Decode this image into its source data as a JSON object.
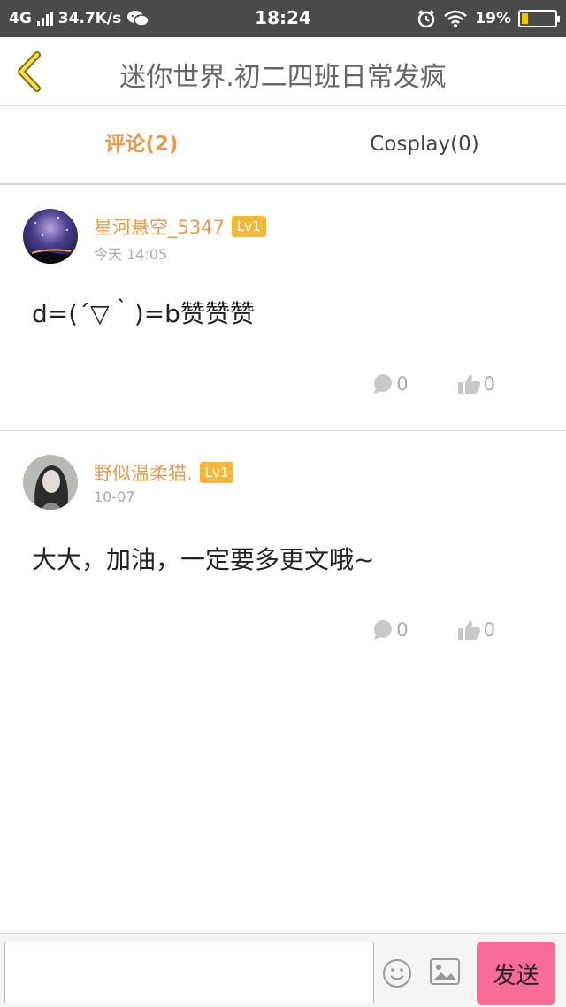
{
  "status_bar": {
    "network": "4G",
    "speed": "34.7K/s",
    "time": "18:24",
    "battery": "19%",
    "battery_level": 0.19
  },
  "header": {
    "title": "迷你世界.初二四班日常发疯"
  },
  "tabs": [
    {
      "label": "评论(2)",
      "active": true
    },
    {
      "label": "Cosplay(0)",
      "active": false
    }
  ],
  "comments": [
    {
      "username": "星河悬空_5347",
      "level": "Lv1",
      "time": "今天 14:05",
      "text": "d=(´▽｀)=b赞赞赞",
      "reply_count": "0",
      "like_count": "0"
    },
    {
      "username": "野似温柔猫.",
      "level": "Lv1",
      "time": "10-07",
      "text": "大大，加油，一定要多更文哦~",
      "reply_count": "0",
      "like_count": "0"
    }
  ],
  "composer": {
    "input_value": "",
    "send_label": "发送"
  },
  "colors": {
    "accent": "#e99a4c",
    "level_badge": "#f1b93a",
    "send_button": "#fa6c98",
    "status_bar": "#4a4a4a"
  },
  "icons": [
    "back-chevron-icon",
    "wechat-icon",
    "alarm-icon",
    "wifi-icon",
    "comment-icon",
    "thumbs-up-icon",
    "emoji-icon",
    "image-icon"
  ]
}
